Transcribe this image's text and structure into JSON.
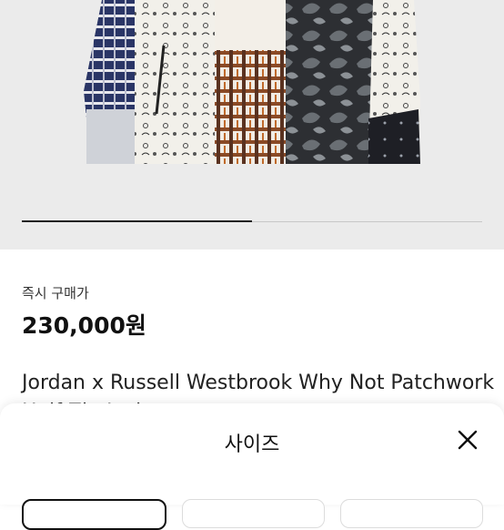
{
  "product_image": {
    "alt": "patchwork jacket product photo"
  },
  "image_carousel": {
    "progress": 0.5
  },
  "price": {
    "label": "즉시 구매가",
    "value": "230,000원"
  },
  "product": {
    "title": "Jordan x Russell Westbrook Why Not Patchwork Half Zip Jacket"
  },
  "size_sheet": {
    "title": "사이즈",
    "close_icon": "close-icon",
    "options": [
      "",
      "",
      ""
    ]
  },
  "colors": {
    "sheet_bg": "#ffffff",
    "page_text": "#222222",
    "hero_bg": "#ebebeb"
  }
}
